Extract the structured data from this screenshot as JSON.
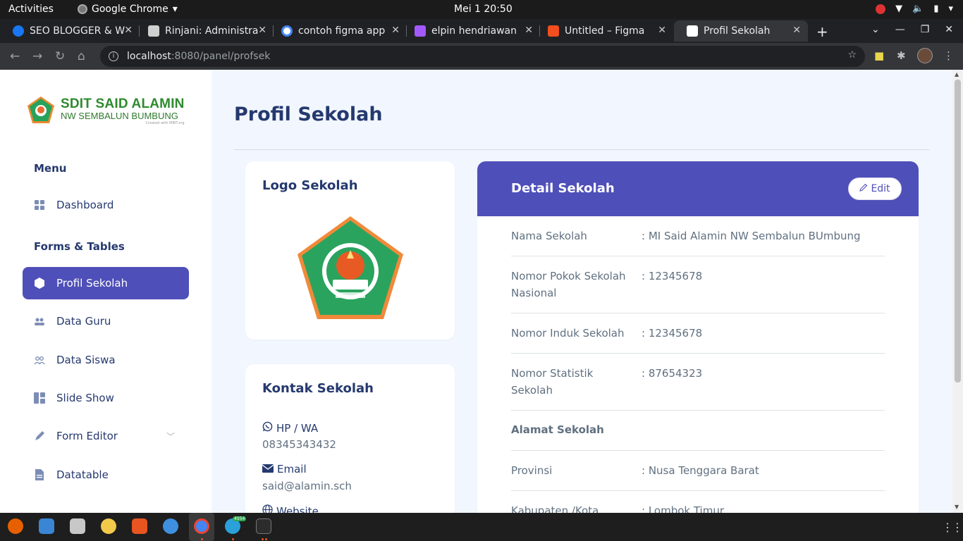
{
  "os": {
    "activities": "Activities",
    "app_name": "Google Chrome",
    "clock": "Mei 1  20:50"
  },
  "browser": {
    "tabs": [
      {
        "title": "SEO BLOGGER & W",
        "favicon_color": "#1877f2",
        "active": false
      },
      {
        "title": "Rinjani: Administra",
        "favicon_color": "#cfcfcf",
        "active": false
      },
      {
        "title": "contoh figma app",
        "favicon_color": "#ffffff",
        "active": false
      },
      {
        "title": "elpin hendriawan",
        "favicon_color": "#a259ff",
        "active": false
      },
      {
        "title": "Untitled – Figma",
        "favicon_color": "#f24e1e",
        "active": false
      },
      {
        "title": "Profil Sekolah",
        "favicon_color": "#ffffff",
        "active": true
      }
    ],
    "url_host": "localhost",
    "url_path": ":8080/panel/profsek"
  },
  "sidebar": {
    "logo_title": "SDIT SAID ALAMIN",
    "logo_subtitle": "NW SEMBALUN BUMBUNG",
    "logo_caption": "Created with MBIT.org",
    "section_menu": "Menu",
    "section_forms": "Forms & Tables",
    "items": [
      {
        "label": "Dashboard",
        "icon": "grid-icon"
      },
      {
        "label": "Profil Sekolah",
        "icon": "hexagon-icon",
        "active": true
      },
      {
        "label": "Data Guru",
        "icon": "people-fill-icon"
      },
      {
        "label": "Data Siswa",
        "icon": "people-outline-icon"
      },
      {
        "label": "Slide Show",
        "icon": "layout-icon"
      },
      {
        "label": "Form Editor",
        "icon": "pen-icon"
      },
      {
        "label": "Datatable",
        "icon": "file-icon"
      }
    ]
  },
  "main": {
    "page_title": "Profil Sekolah",
    "logo_card_title": "Logo Sekolah",
    "contact_card_title": "Kontak Sekolah",
    "contacts": [
      {
        "label": "HP / WA",
        "value": "08345343432",
        "icon": "whatsapp-icon"
      },
      {
        "label": "Email",
        "value": "said@alamin.sch",
        "icon": "envelope-icon"
      },
      {
        "label": "Website",
        "value": "",
        "icon": "globe-icon"
      }
    ],
    "detail_title": "Detail Sekolah",
    "edit_label": "Edit",
    "details": [
      {
        "label": "Nama Sekolah",
        "value": ": MI Said Alamin NW Sembalun BUmbung"
      },
      {
        "label": "Nomor Pokok Sekolah Nasional",
        "value": ": 12345678"
      },
      {
        "label": "Nomor Induk Sekolah",
        "value": ": 12345678"
      },
      {
        "label": "Nomor Statistik Sekolah",
        "value": ": 87654323"
      }
    ],
    "address_section": "Alamat Sekolah",
    "address": [
      {
        "label": "Provinsi",
        "value": ": Nusa Tenggara Barat"
      },
      {
        "label": "Kabupaten /Kota",
        "value": ": Lombok Timur"
      }
    ]
  },
  "dock": {
    "telegram_badge": "4554"
  },
  "colors": {
    "accent": "#4f4fb9",
    "heading": "#25396f",
    "text_muted": "#607080",
    "page_bg": "#f2f7ff"
  }
}
